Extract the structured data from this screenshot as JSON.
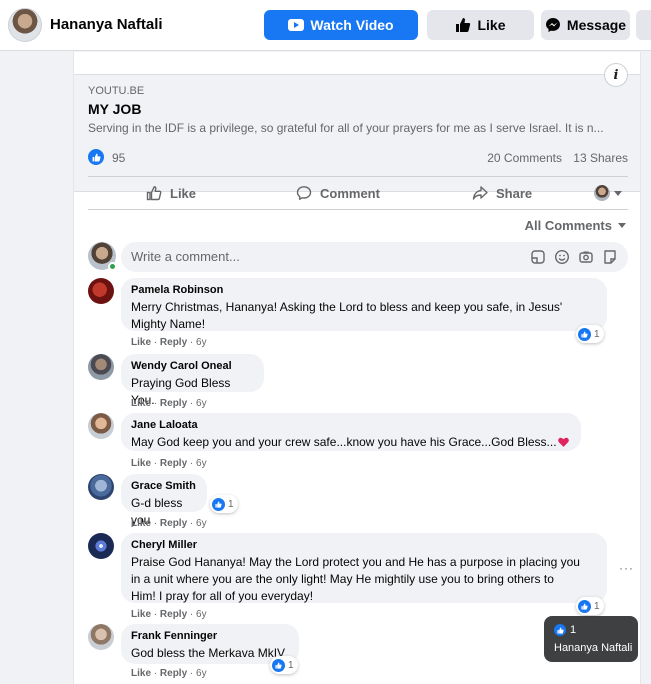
{
  "header": {
    "page_name": "Hananya Naftali",
    "watch_label": "Watch Video",
    "like_label": "Like",
    "message_label": "Message",
    "accent": "#1877f2"
  },
  "post": {
    "link": {
      "domain": "YOUTU.BE",
      "title": "MY JOB",
      "description": "Serving in the IDF is a privilege, so grateful for all of your prayers for me as I serve Israel. It is n..."
    },
    "likes": "95",
    "comments_count": "20 Comments",
    "shares_count": "13 Shares",
    "actions": {
      "like": "Like",
      "comment": "Comment",
      "share": "Share"
    },
    "filter_label": "All Comments",
    "comment_placeholder": "Write a comment..."
  },
  "comments": [
    {
      "name": "Pamela Robinson",
      "lines": [
        "Merry Christmas, Hananya! Asking the Lord to bless and keep you safe, in Jesus'",
        "Mighty Name!"
      ],
      "like": "Like",
      "reply": "Reply",
      "time": "6y",
      "reactions": "1"
    },
    {
      "name": "Wendy Carol Oneal",
      "lines": [
        "Praying God Bless You."
      ],
      "like": "Like",
      "reply": "Reply",
      "time": "6y"
    },
    {
      "name": "Jane Laloata",
      "lines": [
        "May God keep you and your crew safe...know you have his Grace...God Bless..."
      ],
      "like": "Like",
      "reply": "Reply",
      "time": "6y"
    },
    {
      "name": "Grace Smith",
      "lines": [
        "G-d bless you"
      ],
      "like": "Like",
      "reply": "Reply",
      "time": "6y",
      "reactions": "1"
    },
    {
      "name": "Cheryl Miller",
      "lines": [
        "Praise God Hananya! May the Lord protect you and He has a purpose in placing you",
        "in a unit where you are the only light! May He mightily use you to bring others to",
        "Him! I pray for all of you everyday!"
      ],
      "like": "Like",
      "reply": "Reply",
      "time": "6y",
      "reactions": "1"
    },
    {
      "name": "Frank Fenninger",
      "lines": [
        "God bless the Merkava MkIV"
      ],
      "like": "Like",
      "reply": "Reply",
      "time": "6y",
      "reactions": "1"
    }
  ],
  "tooltip": {
    "count": "1",
    "name": "Hananya Naftali"
  },
  "icons": [
    "video-icon",
    "thumbs-up-icon",
    "messenger-icon",
    "info-icon",
    "comment-icon",
    "share-icon",
    "caret-down-icon",
    "sticker-icon",
    "emoji-icon",
    "camera-icon",
    "gif-icon",
    "heart-icon",
    "more-icon"
  ]
}
